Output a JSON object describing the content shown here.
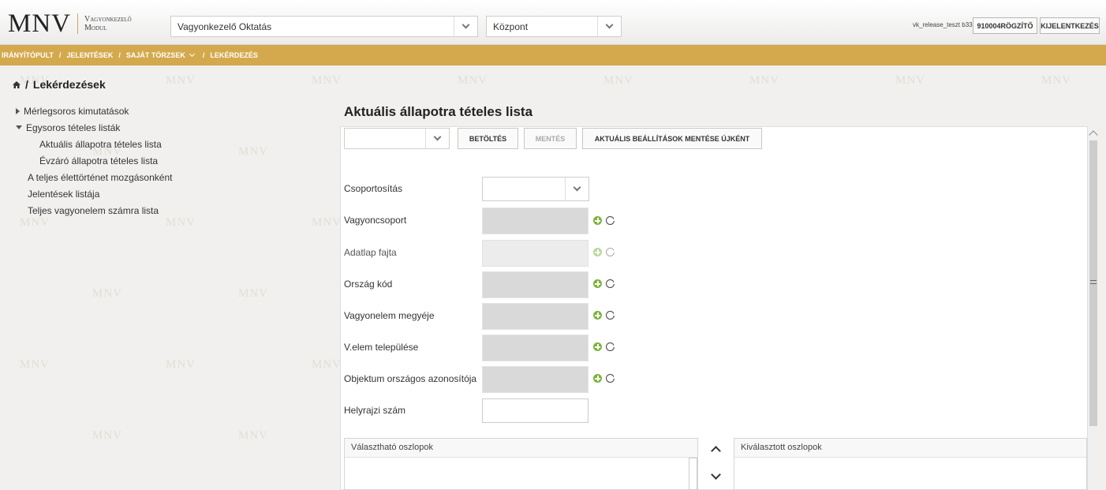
{
  "header": {
    "logo_text": "MNV",
    "logo_sub_1": "Vagyonkezelő",
    "logo_sub_2": "Modul",
    "org_select_value": "Vagyonkezelő Oktatás",
    "unit_select_value": "Központ",
    "user_label": "vk_release_teszt b33",
    "role_button": "910004RÖGZÍTŐ",
    "logout_button": "KIJELENTKEZÉS"
  },
  "nav": {
    "items": [
      "IRÁNYÍTÓPULT",
      "JELENTÉSEK",
      "SAJÁT TÖRZSEK",
      "LEKÉRDEZÉS"
    ],
    "separator": "/"
  },
  "breadcrumb": {
    "separator": "/",
    "current": "Lekérdezések"
  },
  "tree": {
    "items": [
      "Mérlegsoros kimutatások",
      "Egysoros tételes listák",
      "Aktuális állapotra tételes lista",
      "Évzáró állapotra tételes lista",
      "A teljes élettörténet mozgásonként",
      "Jelentések listája",
      "Teljes vagyonelem számra lista"
    ]
  },
  "main": {
    "title": "Aktuális állapotra tételes lista",
    "toolbar": {
      "preset_value": "",
      "load_button": "BETÖLTÉS",
      "save_button": "MENTÉS",
      "save_as_new_button": "AKTUÁLIS BEÁLLÍTÁSOK MENTÉSE ÚJKÉNT"
    },
    "fields": {
      "grouping": "Csoportosítás",
      "asset_group": "Vagyoncsoport",
      "datasheet_type": "Adatlap fajta",
      "country_code": "Ország kód",
      "county": "Vagyonelem megyéje",
      "settlement": "V.elem települése",
      "object_id": "Objektum országos azonosítója",
      "parcel_number": "Helyrajzi szám"
    },
    "columns": {
      "available_header": "Választható oszlopok",
      "selected_header": "Kiválasztott oszlopok"
    }
  },
  "watermark": "MNV"
}
